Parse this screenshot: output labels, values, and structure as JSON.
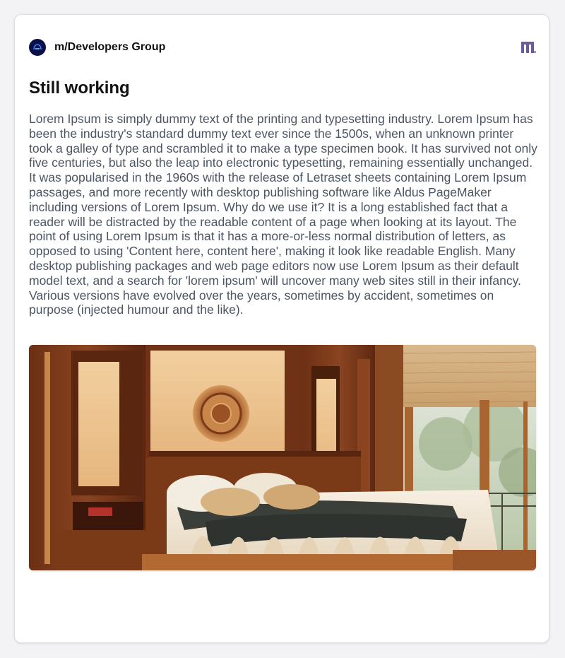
{
  "post": {
    "group": {
      "name": "m/Developers Group",
      "avatar_icon": "group-logo-icon"
    },
    "brand_icon": "m-brand-logo-icon",
    "title": "Still working",
    "body": "Lorem Ipsum is simply dummy text of the printing and typesetting industry. Lorem Ipsum has been the industry's standard dummy text ever since the 1500s, when an unknown printer took a galley of type and scrambled it to make a type specimen book. It has survived not only five centuries, but also the leap into electronic typesetting, remaining essentially unchanged. It was popularised in the 1960s with the release of Letraset sheets containing Lorem Ipsum passages, and more recently with desktop publishing software like Aldus PageMaker including versions of Lorem Ipsum. Why do we use it? It is a long established fact that a reader will be distracted by the readable content of a page when looking at its layout. The point of using Lorem Ipsum is that it has a more-or-less normal distribution of letters, as opposed to using 'Content here, content here', making it look like readable English. Many desktop publishing packages and web page editors now use Lorem Ipsum as their default model text, and a search for 'lorem ipsum' will uncover many web sites still in their infancy. Various versions have evolved over the years, sometimes by accident, sometimes on purpose (injected humour and the like).",
    "image_subject": "wooden-bedroom-photo"
  },
  "colors": {
    "avatar_bg": "#0b0f4a",
    "brand": "#6b5b9a",
    "title": "#111111",
    "body_text": "#4b5563"
  }
}
